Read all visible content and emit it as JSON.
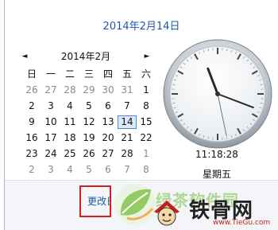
{
  "header": {
    "date_title": "2014年2月14日"
  },
  "calendar": {
    "month_title": "2014年2月",
    "prev_label": "◄",
    "next_label": "►",
    "weekdays": [
      "日",
      "一",
      "二",
      "三",
      "四",
      "五",
      "六"
    ],
    "weeks": [
      [
        {
          "d": "26",
          "o": true
        },
        {
          "d": "27",
          "o": true
        },
        {
          "d": "28",
          "o": true
        },
        {
          "d": "29",
          "o": true
        },
        {
          "d": "30",
          "o": true
        },
        {
          "d": "31",
          "o": true
        },
        {
          "d": "1"
        }
      ],
      [
        {
          "d": "2"
        },
        {
          "d": "3"
        },
        {
          "d": "4"
        },
        {
          "d": "5"
        },
        {
          "d": "6"
        },
        {
          "d": "7"
        },
        {
          "d": "8"
        }
      ],
      [
        {
          "d": "9"
        },
        {
          "d": "10"
        },
        {
          "d": "11"
        },
        {
          "d": "12"
        },
        {
          "d": "13"
        },
        {
          "d": "14",
          "t": true
        },
        {
          "d": "15"
        }
      ],
      [
        {
          "d": "16"
        },
        {
          "d": "17"
        },
        {
          "d": "18"
        },
        {
          "d": "19"
        },
        {
          "d": "20"
        },
        {
          "d": "21"
        },
        {
          "d": "22"
        }
      ],
      [
        {
          "d": "23"
        },
        {
          "d": "24"
        },
        {
          "d": "25"
        },
        {
          "d": "26"
        },
        {
          "d": "27"
        },
        {
          "d": "28"
        },
        {
          "d": "1",
          "o": true
        }
      ],
      [
        {
          "d": "2",
          "o": true
        },
        {
          "d": "3",
          "o": true
        },
        {
          "d": "4",
          "o": true
        },
        {
          "d": "5",
          "o": true
        },
        {
          "d": "6",
          "o": true
        },
        {
          "d": "7",
          "o": true
        },
        {
          "d": "8",
          "o": true
        }
      ]
    ]
  },
  "clock": {
    "time": "11:18:28",
    "weekday": "星期五",
    "hours": 11,
    "minutes": 18,
    "seconds": 28
  },
  "footer": {
    "change_link": "更改日期和时间设置..."
  },
  "watermark": {
    "site_name": "铁骨网",
    "site_url": "www.TieGu.com",
    "overlay_text": "绿茶软件园"
  },
  "colors": {
    "accent": "#1e5aa8",
    "highlight_border": "#d31f1f",
    "today_bg": "#dce9fa"
  }
}
